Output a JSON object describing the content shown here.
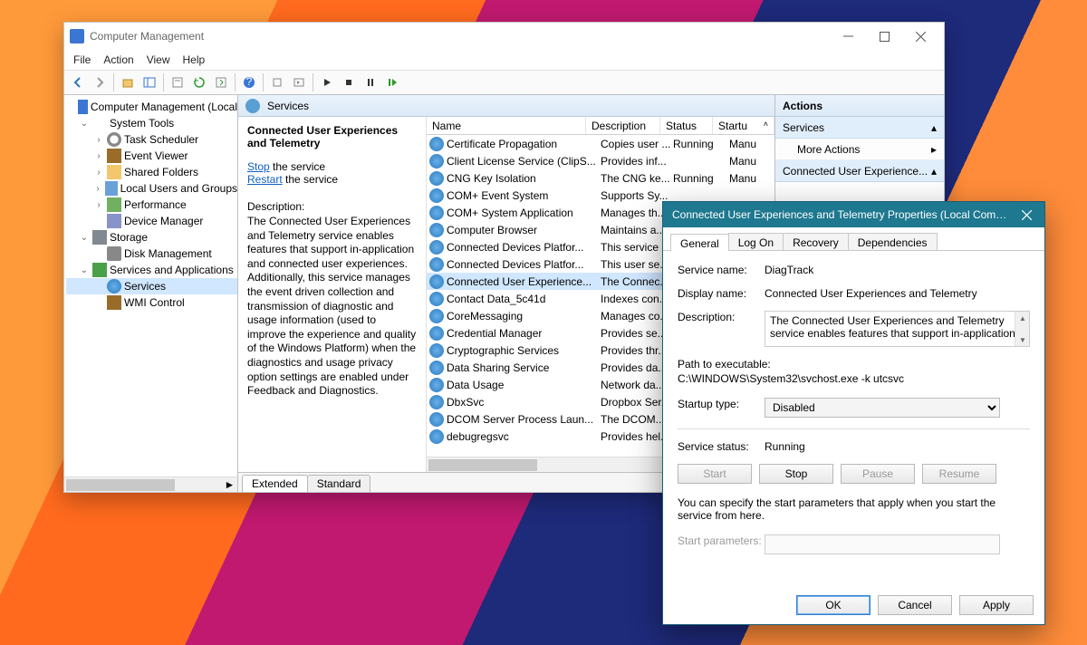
{
  "window": {
    "title": "Computer Management"
  },
  "menubar": [
    "File",
    "Action",
    "View",
    "Help"
  ],
  "tree": {
    "root": "Computer Management (Local",
    "nodes": [
      {
        "label": "System Tools",
        "expanded": true,
        "indent": 1,
        "children": [
          {
            "label": "Task Scheduler",
            "icon": "ic-clock"
          },
          {
            "label": "Event Viewer",
            "icon": "ic-ev"
          },
          {
            "label": "Shared Folders",
            "icon": "ic-folder"
          },
          {
            "label": "Local Users and Groups",
            "icon": "ic-users"
          },
          {
            "label": "Performance",
            "icon": "ic-perf"
          },
          {
            "label": "Device Manager",
            "icon": "ic-dev"
          }
        ]
      },
      {
        "label": "Storage",
        "expanded": true,
        "indent": 1,
        "icon": "ic-store",
        "children": [
          {
            "label": "Disk Management",
            "icon": "ic-disk"
          }
        ]
      },
      {
        "label": "Services and Applications",
        "expanded": true,
        "indent": 1,
        "icon": "ic-svcapp",
        "children": [
          {
            "label": "Services",
            "icon": "ic-gear",
            "selected": true
          },
          {
            "label": "WMI Control",
            "icon": "ic-wmi"
          }
        ]
      }
    ]
  },
  "services_header": "Services",
  "detail": {
    "name": "Connected User Experiences and Telemetry",
    "stop_word": "Stop",
    "stop_suffix": " the service",
    "restart_word": "Restart",
    "restart_suffix": " the service",
    "desc_label": "Description:",
    "description": "The Connected User Experiences and Telemetry service enables features that support in-application and connected user experiences. Additionally, this service manages the event driven collection and transmission of diagnostic and usage information (used to improve the experience and quality of the Windows Platform) when the diagnostics and usage privacy option settings are enabled under Feedback and Diagnostics."
  },
  "columns": {
    "name": "Name",
    "desc": "Description",
    "status": "Status",
    "startup": "Startu"
  },
  "rows": [
    {
      "name": "Certificate Propagation",
      "desc": "Copies user ...",
      "status": "Running",
      "startup": "Manu"
    },
    {
      "name": "Client License Service (ClipS...",
      "desc": "Provides inf...",
      "status": "",
      "startup": "Manu"
    },
    {
      "name": "CNG Key Isolation",
      "desc": "The CNG ke...",
      "status": "Running",
      "startup": "Manu"
    },
    {
      "name": "COM+ Event System",
      "desc": "Supports Sy...",
      "status": "",
      "startup": ""
    },
    {
      "name": "COM+ System Application",
      "desc": "Manages th...",
      "status": "",
      "startup": ""
    },
    {
      "name": "Computer Browser",
      "desc": "Maintains a...",
      "status": "",
      "startup": ""
    },
    {
      "name": "Connected Devices Platfor...",
      "desc": "This service ...",
      "status": "",
      "startup": ""
    },
    {
      "name": "Connected Devices Platfor...",
      "desc": "This user se...",
      "status": "",
      "startup": ""
    },
    {
      "name": "Connected User Experience...",
      "desc": "The Connec...",
      "status": "",
      "startup": "",
      "selected": true
    },
    {
      "name": "Contact Data_5c41d",
      "desc": "Indexes con...",
      "status": "",
      "startup": ""
    },
    {
      "name": "CoreMessaging",
      "desc": "Manages co...",
      "status": "",
      "startup": ""
    },
    {
      "name": "Credential Manager",
      "desc": "Provides se...",
      "status": "",
      "startup": ""
    },
    {
      "name": "Cryptographic Services",
      "desc": "Provides thr...",
      "status": "",
      "startup": ""
    },
    {
      "name": "Data Sharing Service",
      "desc": "Provides da...",
      "status": "",
      "startup": ""
    },
    {
      "name": "Data Usage",
      "desc": "Network da...",
      "status": "",
      "startup": ""
    },
    {
      "name": "DbxSvc",
      "desc": "Dropbox Ser...",
      "status": "",
      "startup": ""
    },
    {
      "name": "DCOM Server Process Laun...",
      "desc": "The DCOM...",
      "status": "",
      "startup": ""
    },
    {
      "name": "debugregsvc",
      "desc": "Provides hel...",
      "status": "",
      "startup": ""
    }
  ],
  "bottom_tabs": {
    "extended": "Extended",
    "standard": "Standard"
  },
  "actions": {
    "header": "Actions",
    "section1": "Services",
    "more1": "More Actions",
    "section2": "Connected User Experience..."
  },
  "dialog": {
    "title": "Connected User Experiences and Telemetry Properties (Local Comp...",
    "tabs": [
      "General",
      "Log On",
      "Recovery",
      "Dependencies"
    ],
    "labels": {
      "service_name": "Service name:",
      "display_name": "Display name:",
      "description": "Description:",
      "path": "Path to executable:",
      "startup_type": "Startup type:",
      "service_status": "Service status:",
      "start_params": "Start parameters:",
      "hint": "You can specify the start parameters that apply when you start the service from here."
    },
    "values": {
      "service_name": "DiagTrack",
      "display_name": "Connected User Experiences and Telemetry",
      "description": "The Connected User Experiences and Telemetry service enables features that support in-application",
      "path": "C:\\WINDOWS\\System32\\svchost.exe -k utcsvc",
      "startup_type": "Disabled",
      "service_status": "Running"
    },
    "buttons": {
      "start": "Start",
      "stop": "Stop",
      "pause": "Pause",
      "resume": "Resume",
      "ok": "OK",
      "cancel": "Cancel",
      "apply": "Apply"
    }
  }
}
